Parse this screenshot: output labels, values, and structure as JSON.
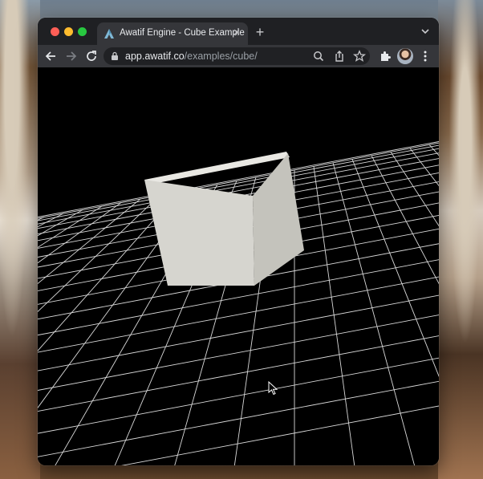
{
  "browser": {
    "tab": {
      "title": "Awatif Engine - Cube Example",
      "favicon": "awatif-logo-icon",
      "close_icon": "close-icon"
    },
    "new_tab_label": "+",
    "address": {
      "host": "app.awatif.co",
      "path": "/examples/cube/"
    },
    "toolbar_icons": [
      "back-icon",
      "forward-icon",
      "reload-icon",
      "lock-icon",
      "zoom-icon",
      "share-icon",
      "star-icon",
      "extensions-icon",
      "profile-avatar",
      "more-menu-icon"
    ]
  },
  "scene": {
    "background": "#000000",
    "grid_color": "#ffffff",
    "cube_color": "#d9d8d2",
    "objects": [
      "ground-grid",
      "cube"
    ]
  }
}
